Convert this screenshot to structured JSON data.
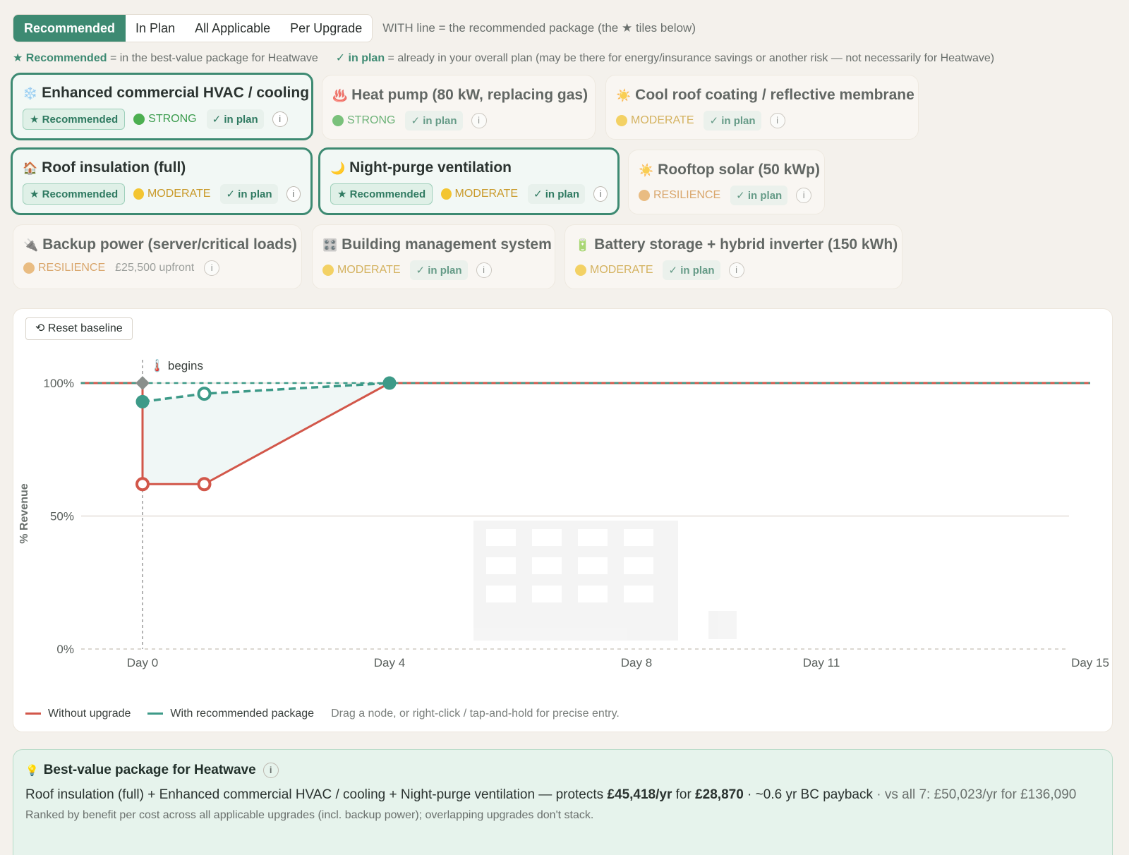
{
  "tabs": [
    "Recommended",
    "In Plan",
    "All Applicable",
    "Per Upgrade"
  ],
  "tab_hint": "WITH line = the recommended package (the ★ tiles below)",
  "legend": {
    "rec_label": "★ Recommended",
    "rec_text": "= in the best-value package for Heatwave",
    "plan_label": "✓ in plan",
    "plan_text": "= already in your overall plan (may be there for energy/insurance savings or another risk — not necessarily for Heatwave)"
  },
  "tiles": [
    {
      "icon": "❄️",
      "title": "Enhanced commercial HVAC / cooling",
      "recommended": "★ Recommended",
      "strength": "STRONG",
      "in_plan": "✓ in plan",
      "info": "i"
    },
    {
      "icon": "♨️",
      "title": "Heat pump (80 kW, replacing gas)",
      "strength": "STRONG",
      "in_plan": "✓ in plan",
      "info": "i"
    },
    {
      "icon": "☀️",
      "title": "Cool roof coating / reflective membrane",
      "strength": "MODERATE",
      "in_plan": "✓ in plan",
      "info": "i"
    },
    {
      "icon": "🏠",
      "title": "Roof insulation (full)",
      "recommended": "★ Recommended",
      "strength": "MODERATE",
      "in_plan": "✓ in plan",
      "info": "i"
    },
    {
      "icon": "🌙",
      "title": "Night-purge ventilation",
      "recommended": "★ Recommended",
      "strength": "MODERATE",
      "in_plan": "✓ in plan",
      "info": "i"
    },
    {
      "icon": "☀️",
      "title": "Rooftop solar (50 kWp)",
      "strength": "RESILIENCE",
      "in_plan": "✓ in plan",
      "info": "i"
    },
    {
      "icon": "🔌",
      "title": "Backup power (server/critical loads)",
      "strength": "RESILIENCE",
      "upfront": "£25,500 upfront",
      "info": "i"
    },
    {
      "icon": "🎛️",
      "title": "Building management system",
      "strength": "MODERATE",
      "in_plan": "✓ in plan",
      "info": "i"
    },
    {
      "icon": "🔋",
      "title": "Battery storage + hybrid inverter (150 kWh)",
      "strength": "MODERATE",
      "in_plan": "✓ in plan",
      "info": "i"
    }
  ],
  "chart": {
    "reset_label": "⟲ Reset baseline",
    "event_label": "🌡️ begins",
    "legend_without": "Without upgrade",
    "legend_with": "With recommended package",
    "hint": "Drag a node, or right-click / tap-and-hold for precise entry."
  },
  "chart_data": {
    "type": "line",
    "ylabel": "% Revenue",
    "xlabel": "",
    "x_ticks": [
      "Day 0",
      "Day 4",
      "Day 8",
      "Day 11",
      "Day 15"
    ],
    "y_ticks": [
      "0%",
      "50%",
      "100%"
    ],
    "ylim": [
      0,
      100
    ],
    "xlim": [
      -1,
      15
    ],
    "event_day": 0,
    "series": [
      {
        "name": "Without upgrade",
        "color": "#d2574a",
        "points": [
          [
            -1,
            100
          ],
          [
            0,
            100
          ],
          [
            0,
            62
          ],
          [
            1,
            62
          ],
          [
            4,
            100
          ],
          [
            15,
            100
          ]
        ],
        "nodes": [
          [
            0,
            62
          ],
          [
            1,
            62
          ]
        ]
      },
      {
        "name": "With recommended package",
        "color": "#3d9a88",
        "points": [
          [
            0,
            93
          ],
          [
            1,
            96
          ],
          [
            4,
            100
          ]
        ],
        "nodes": [
          [
            0,
            93
          ],
          [
            1,
            96
          ],
          [
            4,
            100
          ]
        ]
      }
    ]
  },
  "package": {
    "icon": "💡",
    "title": "Best-value package for Heatwave",
    "info": "i",
    "line_a": "Roof insulation (full) + Enhanced commercial HVAC / cooling + Night-purge ventilation — protects ",
    "protects": "£45,418/yr",
    "for_word": " for ",
    "cost": "£28,870",
    "payback": " · ~0.6 yr BC payback",
    "vs_all": " · vs all 7: £50,023/yr for £136,090",
    "note": "Ranked by benefit per cost across all applicable upgrades (incl. backup power); overlapping upgrades don't stack."
  },
  "colors": {
    "accent": "#3d8a72",
    "without": "#d2574a",
    "with": "#3d9a88"
  }
}
